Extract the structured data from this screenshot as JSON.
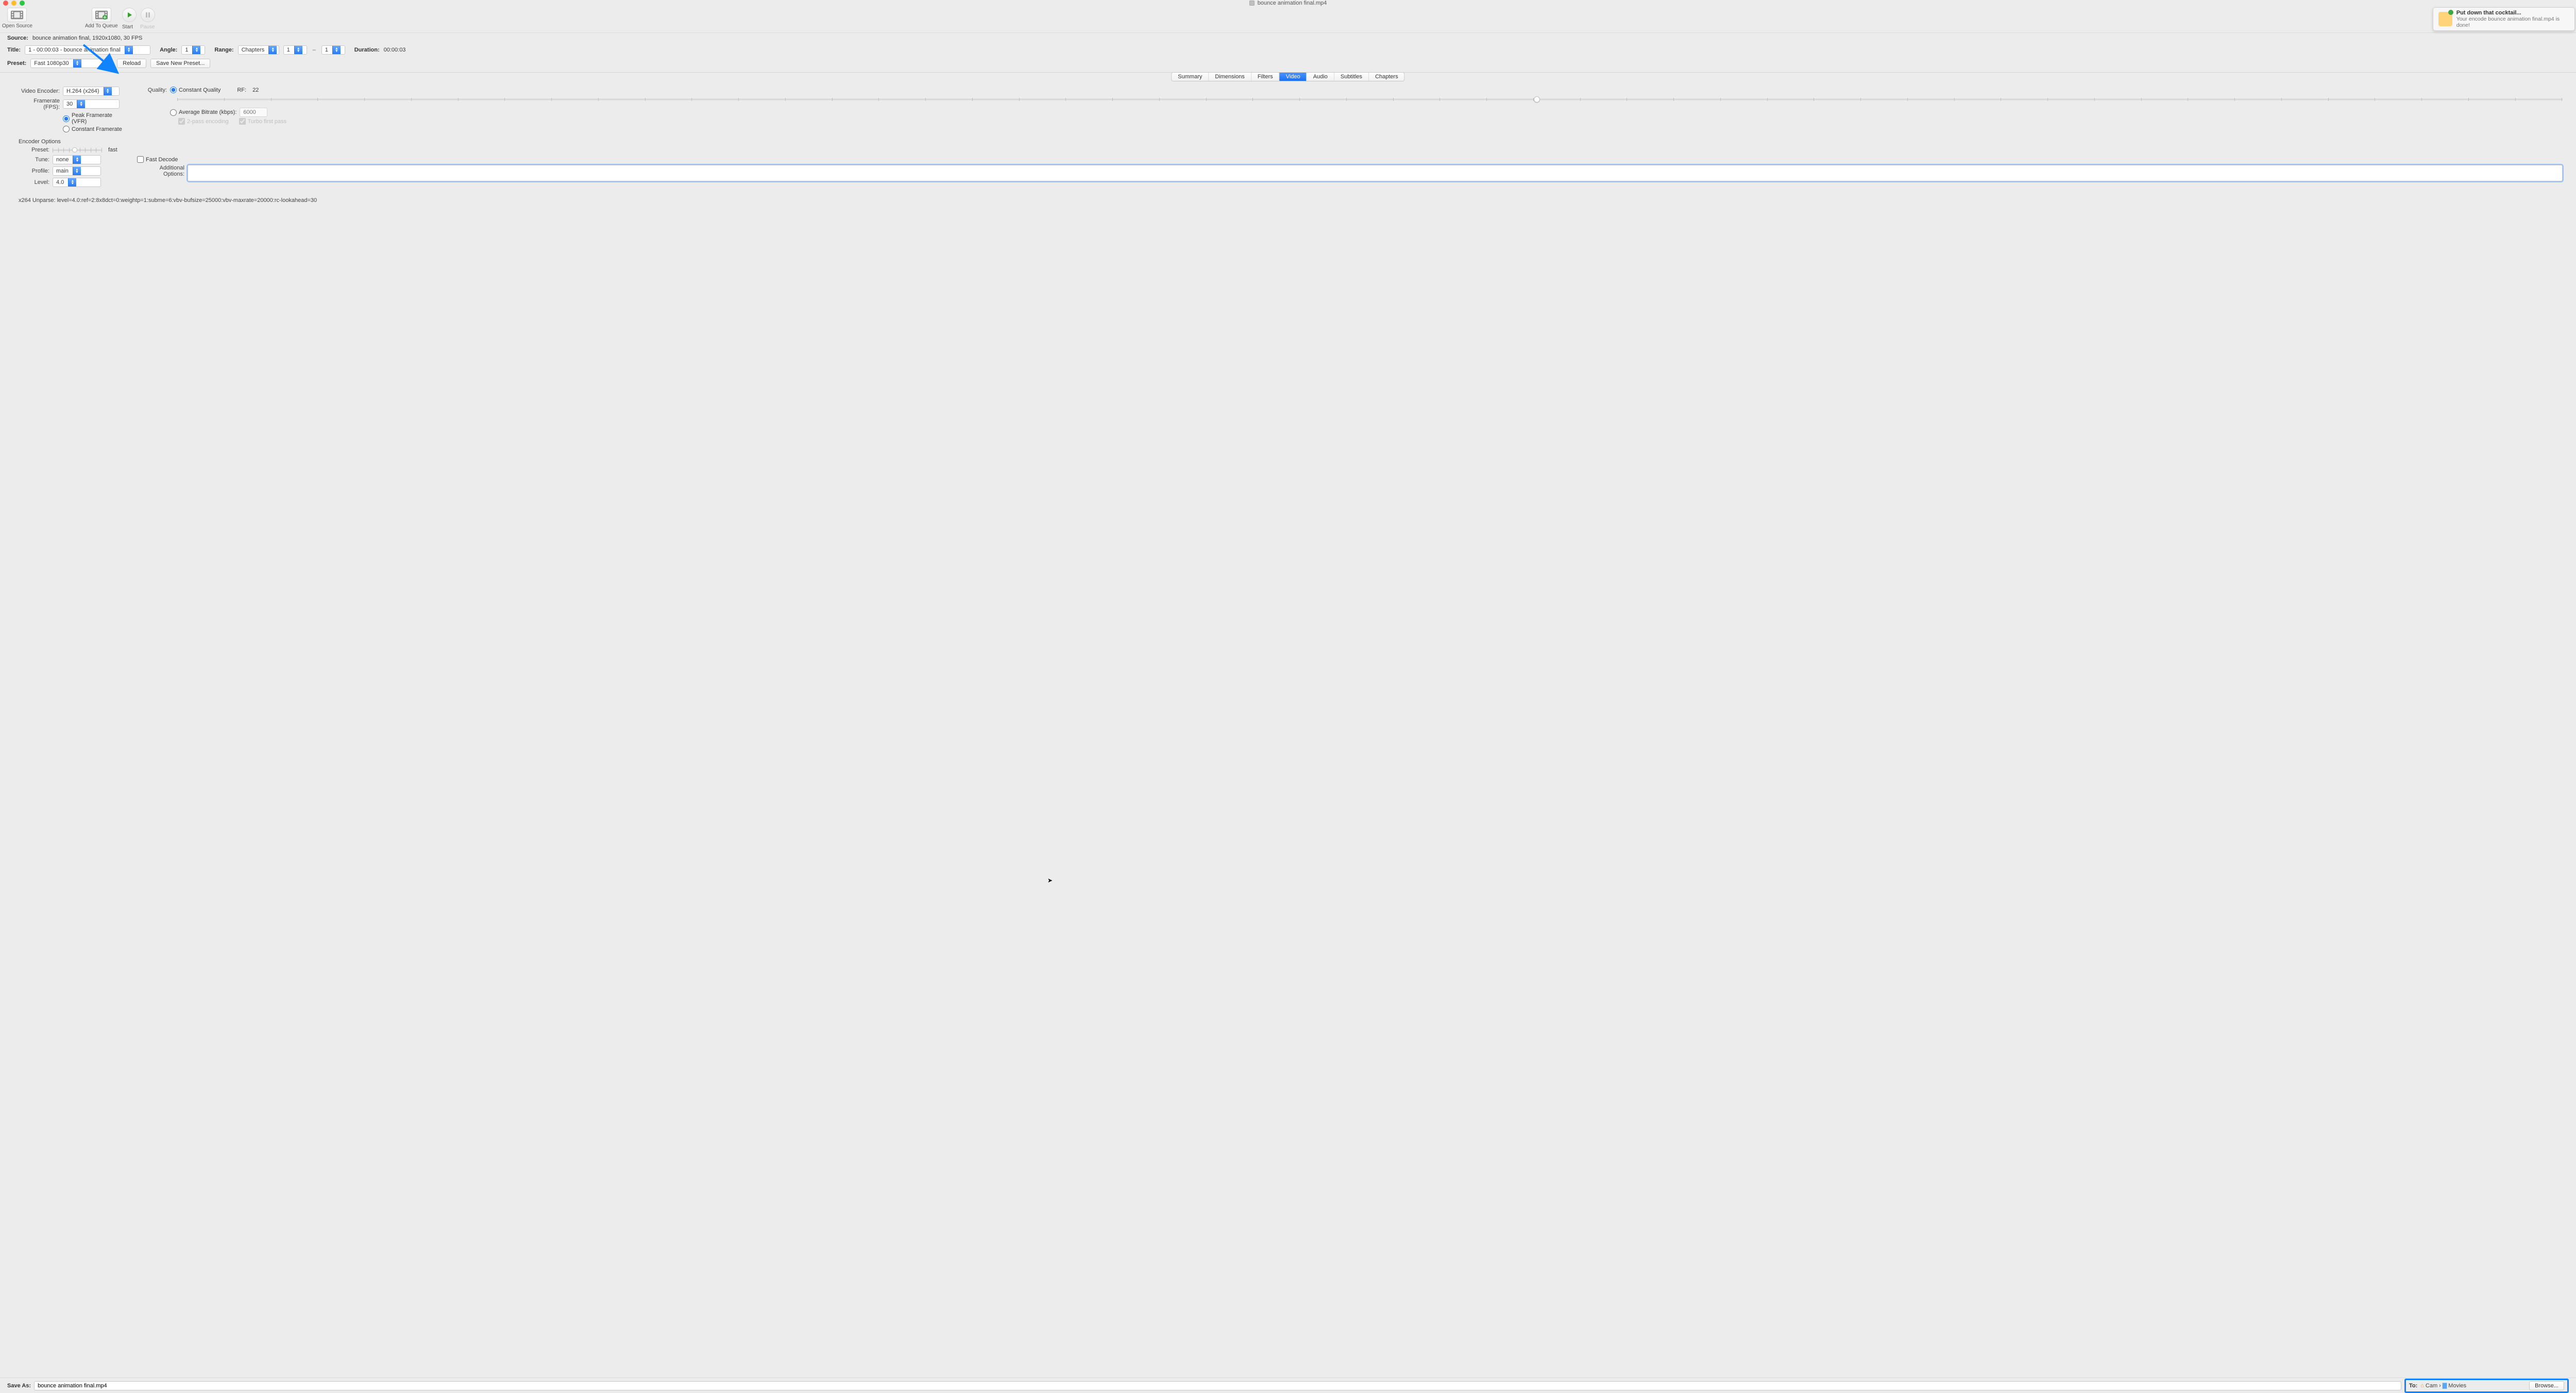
{
  "window": {
    "title": "bounce animation final.mp4"
  },
  "toolbar": {
    "open_source": "Open Source",
    "add_to_queue": "Add To Queue",
    "start": "Start",
    "pause": "Pause"
  },
  "source": {
    "label": "Source:",
    "value": "bounce animation final, 1920x1080, 30 FPS"
  },
  "title_row": {
    "label": "Title:",
    "title_value": "1 - 00:00:03 - bounce animation final",
    "angle_label": "Angle:",
    "angle_value": "1",
    "range_label": "Range:",
    "range_mode": "Chapters",
    "range_from": "1",
    "range_to": "1",
    "duration_label": "Duration:",
    "duration_value": "00:00:03"
  },
  "preset_row": {
    "label": "Preset:",
    "value": "Fast 1080p30",
    "reload": "Reload",
    "save_new": "Save New Preset..."
  },
  "tabs": [
    "Summary",
    "Dimensions",
    "Filters",
    "Video",
    "Audio",
    "Subtitles",
    "Chapters"
  ],
  "active_tab": "Video",
  "video": {
    "encoder_label": "Video Encoder:",
    "encoder_value": "H.264 (x264)",
    "fps_label": "Framerate (FPS):",
    "fps_value": "30",
    "fps_peak": "Peak Framerate (VFR)",
    "fps_const": "Constant Framerate",
    "quality_label": "Quality:",
    "cq_label": "Constant Quality",
    "rf_label": "RF:",
    "rf_value": "22",
    "abr_label": "Average Bitrate (kbps):",
    "abr_value": "6000",
    "two_pass": "2-pass encoding",
    "turbo": "Turbo first pass",
    "encoder_options_hdr": "Encoder Options",
    "preset_label": "Preset:",
    "preset_fast": "fast",
    "tune_label": "Tune:",
    "tune_value": "none",
    "fast_decode": "Fast Decode",
    "profile_label": "Profile:",
    "profile_value": "main",
    "level_label": "Level:",
    "level_value": "4.0",
    "add_opts_label": "Additional Options:",
    "add_opts_value": "",
    "unparse": "x264 Unparse: level=4.0:ref=2:8x8dct=0:weightp=1:subme=6:vbv-bufsize=25000:vbv-maxrate=20000:rc-lookahead=30"
  },
  "bottom": {
    "save_as_label": "Save As:",
    "save_as_value": "bounce animation final.mp4",
    "to_label": "To:",
    "dest_user": "Cam",
    "dest_folder": "Movies",
    "browse": "Browse..."
  },
  "notification": {
    "title": "Put down that cocktail...",
    "subtitle": "Your encode bounce animation final.mp4 is done!"
  }
}
